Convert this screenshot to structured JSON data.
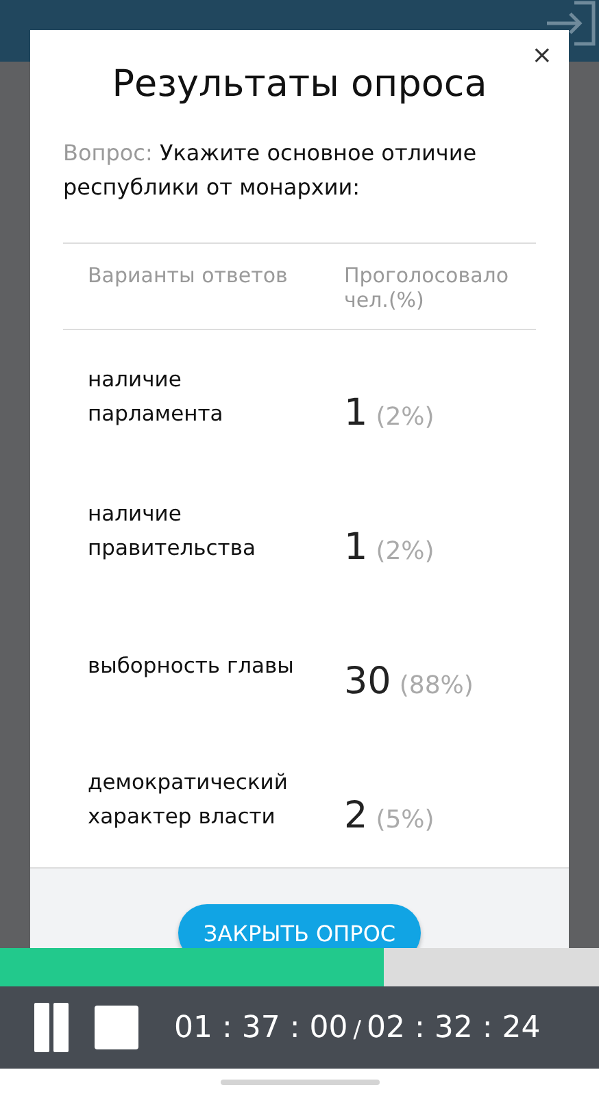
{
  "dialog": {
    "title": "Результаты опроса",
    "close": "×",
    "question_label": "Вопрос:",
    "question": "Укажите основное отличие республики от монархии:",
    "columns": [
      "Варианты ответов",
      "Проголосовало чел.(%)"
    ],
    "rows": [
      {
        "answer": "наличие парламента",
        "votes": "1",
        "percent": "(2%)"
      },
      {
        "answer": "наличие правительства",
        "votes": "1",
        "percent": "(2%)"
      },
      {
        "answer": "выборность главы",
        "votes": "30",
        "percent": "(88%)"
      },
      {
        "answer": "демократический характер власти",
        "votes": "2",
        "percent": "(5%)"
      }
    ],
    "button": "ЗАКРЫТЬ ОПРОС"
  },
  "player": {
    "progress": {
      "level": 0.64
    },
    "elapsed": "01 : 37 : 00",
    "separator": "/",
    "total": "02 : 32 : 24"
  }
}
